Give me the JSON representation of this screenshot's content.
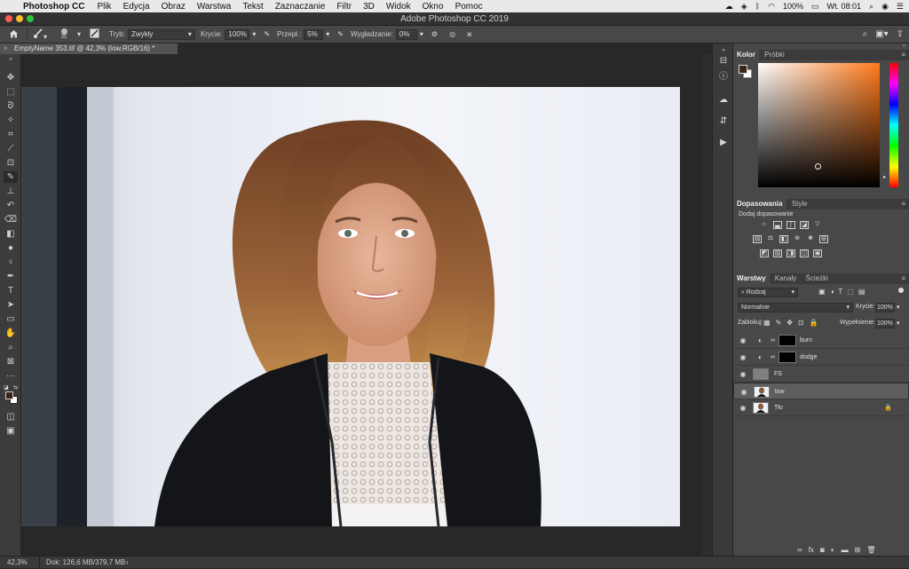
{
  "menubar": {
    "app": "Photoshop CC",
    "items": [
      "Plik",
      "Edycja",
      "Obraz",
      "Warstwa",
      "Tekst",
      "Zaznaczanie",
      "Filtr",
      "3D",
      "Widok",
      "Okno",
      "Pomoc"
    ],
    "battery": "100%",
    "clock": "Wt. 08:01"
  },
  "window": {
    "title": "Adobe Photoshop CC 2019"
  },
  "options": {
    "brush_size": "35",
    "tryb_label": "Tryb:",
    "tryb_value": "Zwykły",
    "krycie_label": "Krycie:",
    "krycie_value": "100%",
    "przepl_label": "Przepł.:",
    "przepl_value": "5%",
    "wygladzanie_label": "Wygładzanie:",
    "wygladzanie_value": "0%"
  },
  "document": {
    "tab": "EmptyName 353.tif @ 42,3% (low,RGB/16) *"
  },
  "status": {
    "zoom": "42,3%",
    "doc": "Dok: 126,6 MB/379,7 MB",
    "arrow": "›"
  },
  "color_panel": {
    "tabs": [
      "Kolor",
      "Próbki"
    ],
    "foreground": "#3b2418",
    "background": "#ffffff",
    "hue": "#ff7a1a"
  },
  "adjustments_panel": {
    "tabs": [
      "Dopasowania",
      "Style"
    ],
    "subtitle": "Dodaj dopasowanie"
  },
  "layers_panel": {
    "tabs": [
      "Warstwy",
      "Kanały",
      "Ścieżki"
    ],
    "filter": "Rodzaj",
    "blend": "Normalnie",
    "opacity_label": "Krycie:",
    "opacity": "100%",
    "lock_label": "Zablokuj:",
    "fill_label": "Wypełnienie:",
    "fill": "100%",
    "layers": [
      {
        "name": "burn"
      },
      {
        "name": "dodge"
      },
      {
        "name": "FS"
      },
      {
        "name": "low"
      },
      {
        "name": "Tło"
      }
    ]
  },
  "icons": [
    "home-icon",
    "brush-icon",
    "airbrush-icon",
    "pressure-icon",
    "gear-icon",
    "butterfly-icon",
    "search-icon",
    "workspace-icon",
    "share-icon",
    "eye-icon",
    "lock-icon",
    "link-icon",
    "trash-icon",
    "fx-icon",
    "folder-icon",
    "mask-icon"
  ]
}
